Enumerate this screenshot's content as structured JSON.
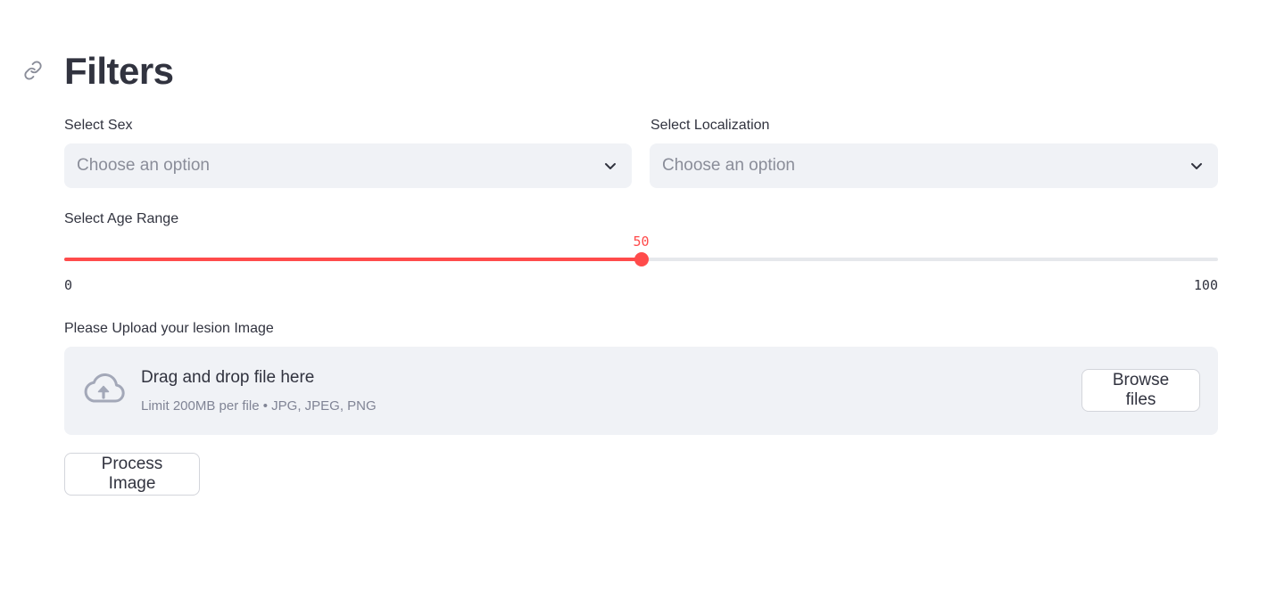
{
  "header": {
    "title": "Filters",
    "anchor_icon": "link-icon"
  },
  "filters": {
    "sex": {
      "label": "Select Sex",
      "placeholder": "Choose an option",
      "icon": "chevron-down-icon"
    },
    "localization": {
      "label": "Select Localization",
      "placeholder": "Choose an option",
      "icon": "chevron-down-icon"
    },
    "age": {
      "label": "Select Age Range",
      "min": 0,
      "max": 100,
      "value": 50,
      "min_label": "0",
      "max_label": "100",
      "value_label": "50",
      "accent_color": "#ff4b4b"
    }
  },
  "upload": {
    "label": "Please Upload your lesion Image",
    "drop_text": "Drag and drop file here",
    "limit_text": "Limit 200MB per file • JPG, JPEG, PNG",
    "browse_label": "Browse files",
    "icon": "cloud-upload-icon"
  },
  "actions": {
    "process_label": "Process Image"
  },
  "colors": {
    "text": "#31333f",
    "input_bg": "#f0f2f6",
    "accent": "#ff4b4b",
    "muted": "#808495"
  }
}
